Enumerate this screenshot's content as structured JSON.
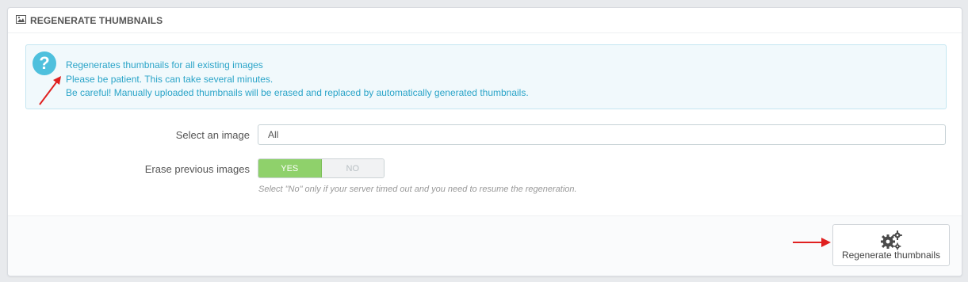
{
  "panel": {
    "title": "REGENERATE THUMBNAILS",
    "title_icon": "picture-icon"
  },
  "alert": {
    "icon": "question-icon",
    "lines": [
      "Regenerates thumbnails for all existing images",
      "Please be patient. This can take several minutes.",
      "Be careful! Manually uploaded thumbnails will be erased and replaced by automatically generated thumbnails."
    ]
  },
  "form": {
    "select_label": "Select an image",
    "select_value": "All",
    "erase_label": "Erase previous images",
    "erase_yes": "YES",
    "erase_no": "NO",
    "erase_selected": "YES",
    "erase_help": "Select \"No\" only if your server timed out and you need to resume the regeneration."
  },
  "footer": {
    "button_label": "Regenerate thumbnails",
    "button_icon": "gears-icon"
  },
  "colors": {
    "alert_text": "#2aa4c8",
    "switch_on": "#8fd16b",
    "annotation_arrow": "#e02020"
  }
}
